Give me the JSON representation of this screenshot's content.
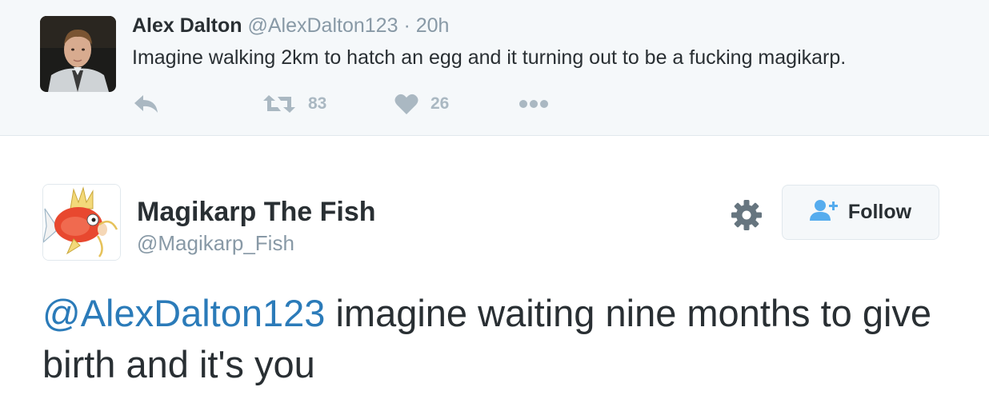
{
  "parent_tweet": {
    "name": "Alex Dalton",
    "handle": "@AlexDalton123",
    "separator": "·",
    "time": "20h",
    "text": "Imagine walking 2km to hatch an egg and it turning out to be a fucking magikarp.",
    "retweet_count": "83",
    "like_count": "26",
    "icons": [
      "reply-icon",
      "retweet-icon",
      "heart-icon",
      "more-icon"
    ]
  },
  "main_tweet": {
    "name": "Magikarp The Fish",
    "handle": "@Magikarp_Fish",
    "follow_label": "Follow",
    "mention": "@AlexDalton123",
    "text_rest": " imagine waiting nine months to give birth and it's you",
    "icons": [
      "gear-icon",
      "follow-user-icon"
    ]
  },
  "colors": {
    "link": "#2b7bb9",
    "muted": "#8899a6",
    "action_icon": "#aab8c2",
    "text": "#292f33",
    "parent_background": "#f5f8fa"
  }
}
